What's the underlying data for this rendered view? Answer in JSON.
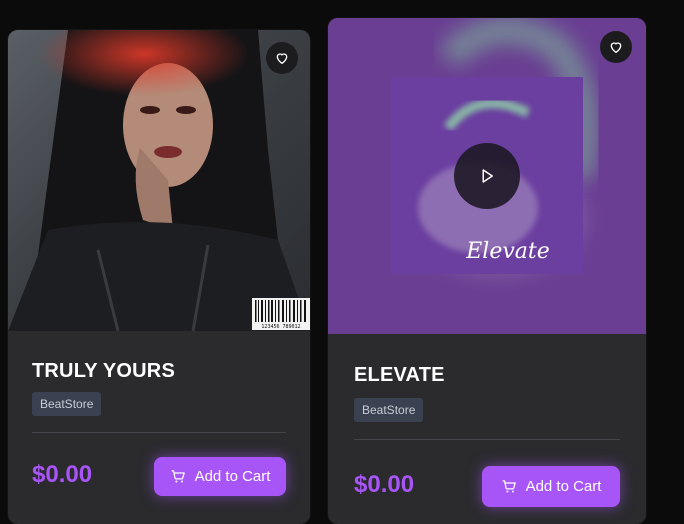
{
  "products": [
    {
      "title": "TRULY YOURS",
      "badge": "BeatStore",
      "price": "$0.00",
      "cart_label": "Add to Cart",
      "barcode_digits": "123456 789012"
    },
    {
      "title": "ELEVATE",
      "badge": "BeatStore",
      "price": "$0.00",
      "cart_label": "Add to Cart",
      "cover_text": "Elevate"
    }
  ],
  "icons": {
    "favorite": "heart-icon",
    "cart": "cart-icon",
    "play": "play-icon"
  },
  "colors": {
    "accent": "#a855f7",
    "card": "#2b2b2e",
    "background": "#0b0b0c",
    "badge": "#3a4150"
  }
}
